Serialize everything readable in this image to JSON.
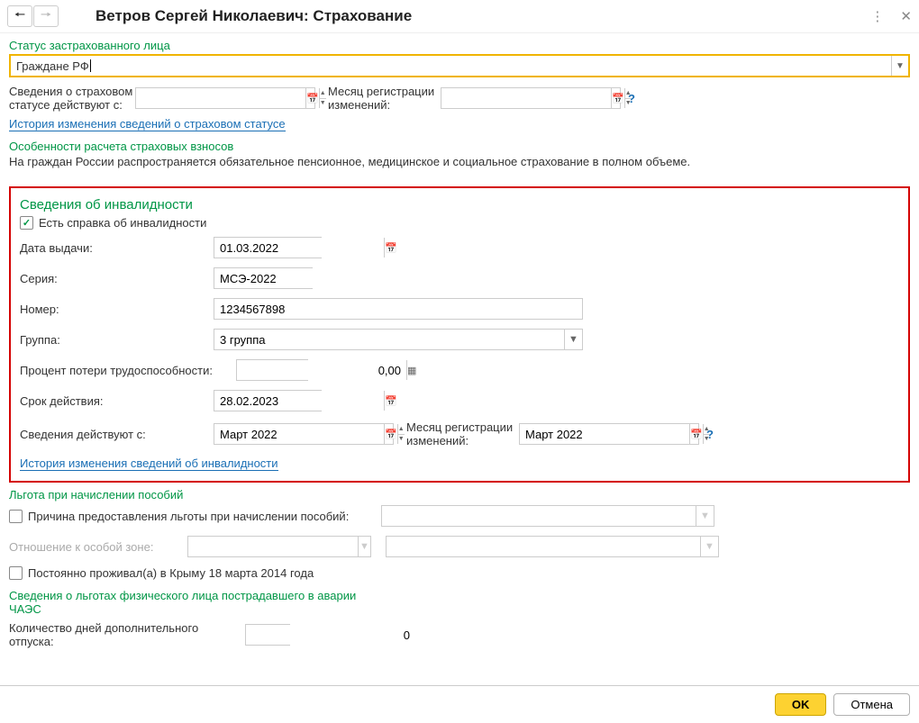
{
  "header": {
    "title": "Ветров Сергей Николаевич: Страхование"
  },
  "status": {
    "section_label": "Статус застрахованного лица",
    "value": "Граждане РФ",
    "valid_from_label": "Сведения о страховом статусе действуют с:",
    "valid_from_value": "",
    "change_month_label": "Месяц регистрации изменений:",
    "change_month_value": "",
    "history_link": "История изменения сведений о страховом статусе"
  },
  "features": {
    "label": "Особенности расчета страховых взносов",
    "text": "На граждан России распространяется обязательное пенсионное, медицинское и социальное страхование в полном объеме."
  },
  "disability": {
    "section_label": "Сведения об инвалидности",
    "has_cert_label": "Есть справка об инвалидности",
    "has_cert_checked": true,
    "issue_date_label": "Дата выдачи:",
    "issue_date_value": "01.03.2022",
    "series_label": "Серия:",
    "series_value": "МСЭ-2022",
    "number_label": "Номер:",
    "number_value": "1234567898",
    "group_label": "Группа:",
    "group_value": "3 группа",
    "percent_label": "Процент потери трудоспособности:",
    "percent_value": "0,00",
    "valid_until_label": "Срок действия:",
    "valid_until_value": "28.02.2023",
    "valid_from_label": "Сведения действуют с:",
    "valid_from_value": "Март 2022",
    "change_month_label": "Месяц регистрации изменений:",
    "change_month_value": "Март 2022",
    "history_link": "История изменения сведений об инвалидности"
  },
  "benefit": {
    "section_label": "Льгота при начислении пособий",
    "reason_checked": false,
    "reason_label": "Причина предоставления льготы при начислении пособий:",
    "reason_value": "",
    "zone_label": "Отношение к особой зоне:",
    "zone_value": "",
    "crimea_checked": false,
    "crimea_label": "Постоянно проживал(а) в Крыму 18 марта 2014 года"
  },
  "chaes": {
    "label": "Сведения о льготах физического лица пострадавшего в аварии ЧАЭС",
    "extra_days_label": "Количество дней дополнительного отпуска:",
    "extra_days_value": "0"
  },
  "footer": {
    "ok": "OK",
    "cancel": "Отмена"
  }
}
